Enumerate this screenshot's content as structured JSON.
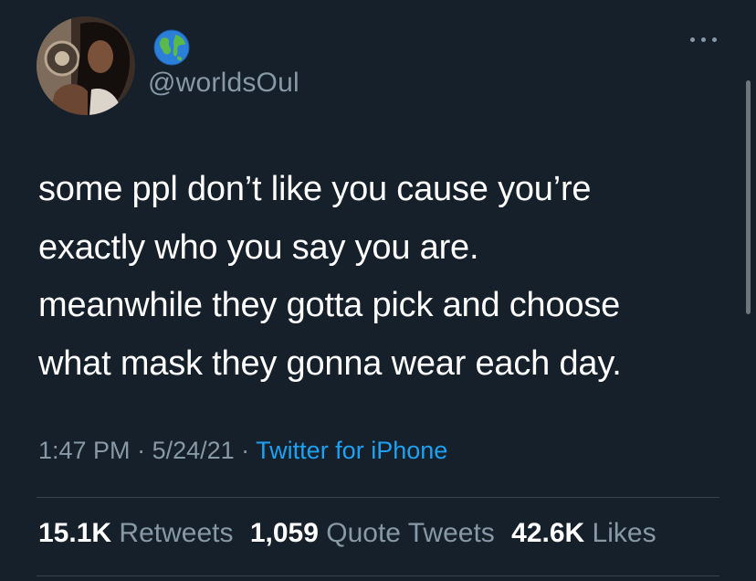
{
  "author": {
    "handle": "@worldsOul",
    "avatar": "avatar",
    "badge_icon": "globe-icon"
  },
  "menu": {
    "icon": "more-icon"
  },
  "tweet": {
    "lines": [
      "some ppl don’t like you cause you’re",
      "exactly who you say you are.",
      "meanwhile they gotta pick and choose",
      "what mask they gonna wear each day."
    ]
  },
  "meta": {
    "time": "1:47 PM",
    "sep1": " · ",
    "date": "5/24/21",
    "sep2": " · ",
    "source": "Twitter for iPhone"
  },
  "stats": {
    "retweets_count": "15.1K",
    "retweets_label": "Retweets",
    "quotes_count": "1,059",
    "quotes_label": "Quote Tweets",
    "likes_count": "42.6K",
    "likes_label": "Likes"
  },
  "colors": {
    "background": "#15202b",
    "text": "#ffffff",
    "muted": "#8899a6",
    "accent": "#1da1f2",
    "divider": "#38444d"
  }
}
